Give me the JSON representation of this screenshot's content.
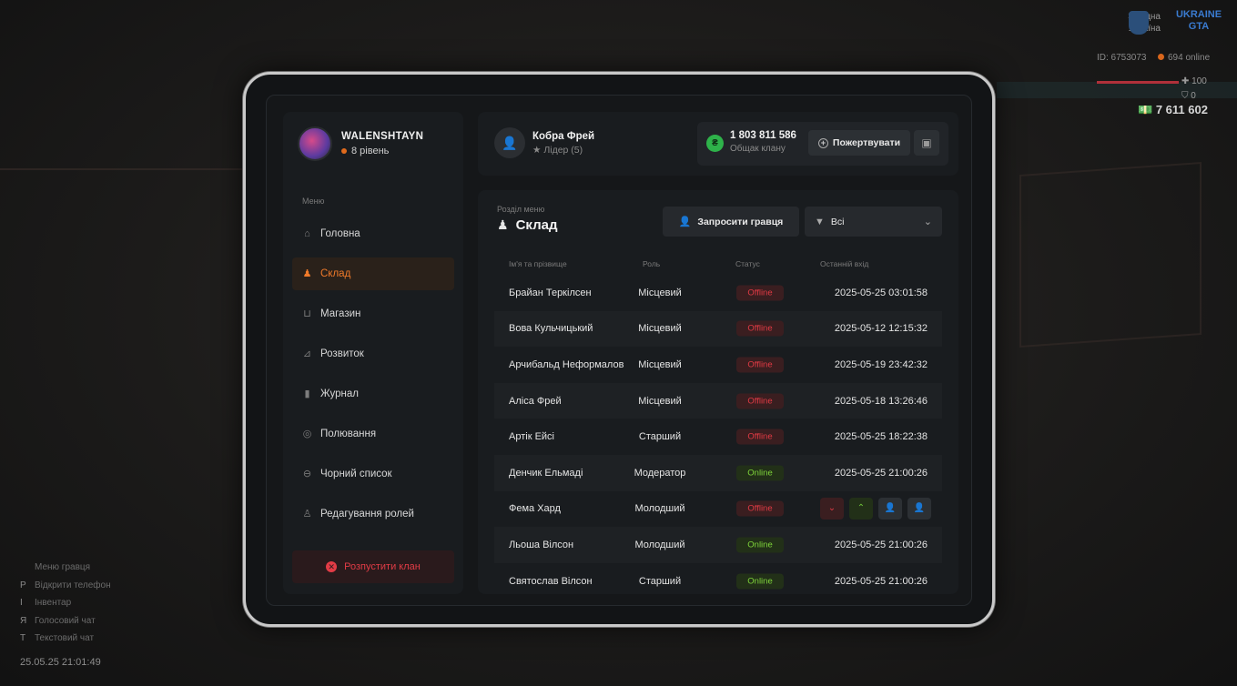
{
  "hud": {
    "region": [
      "Західна",
      "Україна"
    ],
    "logo": "UKRAINE GTA",
    "id_text": "ID: 6753073",
    "online_text": "694 online",
    "hp": "100",
    "armor": "0",
    "money": "7 611 602"
  },
  "hints": [
    {
      "key": "",
      "label": "Меню гравця"
    },
    {
      "key": "P",
      "label": "Відкрити телефон"
    },
    {
      "key": "I",
      "label": "Інвентар"
    },
    {
      "key": "Я",
      "label": "Голосовий чат"
    },
    {
      "key": "T",
      "label": "Текстовий чат"
    }
  ],
  "clock": "25.05.25 21:01:49",
  "profile": {
    "name": "WALENSHTAYN",
    "level": "8 рівень"
  },
  "menu": {
    "label": "Меню",
    "items": [
      {
        "label": "Головна",
        "icon": "home-icon",
        "glyph": "⌂"
      },
      {
        "label": "Склад",
        "icon": "people-icon",
        "glyph": "♟"
      },
      {
        "label": "Магазин",
        "icon": "basket-icon",
        "glyph": "⊔"
      },
      {
        "label": "Розвиток",
        "icon": "chart-icon",
        "glyph": "⊿"
      },
      {
        "label": "Журнал",
        "icon": "book-icon",
        "glyph": "▮"
      },
      {
        "label": "Полювання",
        "icon": "target-icon",
        "glyph": "◎"
      },
      {
        "label": "Чорний список",
        "icon": "block-icon",
        "glyph": "⊖"
      },
      {
        "label": "Редагування ролей",
        "icon": "user-edit-icon",
        "glyph": "♙"
      }
    ],
    "active_index": 1
  },
  "disband_label": "Розпустити клан",
  "leader": {
    "name": "Кобра Фрей",
    "role": "Лідер (5)"
  },
  "bank": {
    "amount": "1 803 811 586",
    "label": "Общак клану",
    "donate": "Пожертвувати"
  },
  "section": {
    "label": "Розділ меню",
    "title": "Склад"
  },
  "invite_label": "Запросити гравця",
  "filter_value": "Всі",
  "columns": [
    "Ім'я та прізвище",
    "Роль",
    "Статус",
    "Останній вхід"
  ],
  "members": [
    {
      "name": "Брайан Теркілсен",
      "role": "Місцевий",
      "status": "Offline",
      "last": "2025-05-25 03:01:58"
    },
    {
      "name": "Вова Кульчицький",
      "role": "Місцевий",
      "status": "Offline",
      "last": "2025-05-12 12:15:32"
    },
    {
      "name": "Арчибальд Неформалов",
      "role": "Місцевий",
      "status": "Offline",
      "last": "2025-05-19 23:42:32"
    },
    {
      "name": "Аліса Фрей",
      "role": "Місцевий",
      "status": "Offline",
      "last": "2025-05-18 13:26:46"
    },
    {
      "name": "Артік Ейсі",
      "role": "Старший",
      "status": "Offline",
      "last": "2025-05-25 18:22:38"
    },
    {
      "name": "Денчик Ельмаді",
      "role": "Модератор",
      "status": "Online",
      "last": "2025-05-25 21:00:26"
    },
    {
      "name": "Фема Хард",
      "role": "Молодший",
      "status": "Offline",
      "last": ""
    },
    {
      "name": "Льоша Вілсон",
      "role": "Молодший",
      "status": "Online",
      "last": "2025-05-25 21:00:26"
    },
    {
      "name": "Святослав Вілсон",
      "role": "Старший",
      "status": "Online",
      "last": "2025-05-25 21:00:26"
    }
  ],
  "hovered_row": 6
}
